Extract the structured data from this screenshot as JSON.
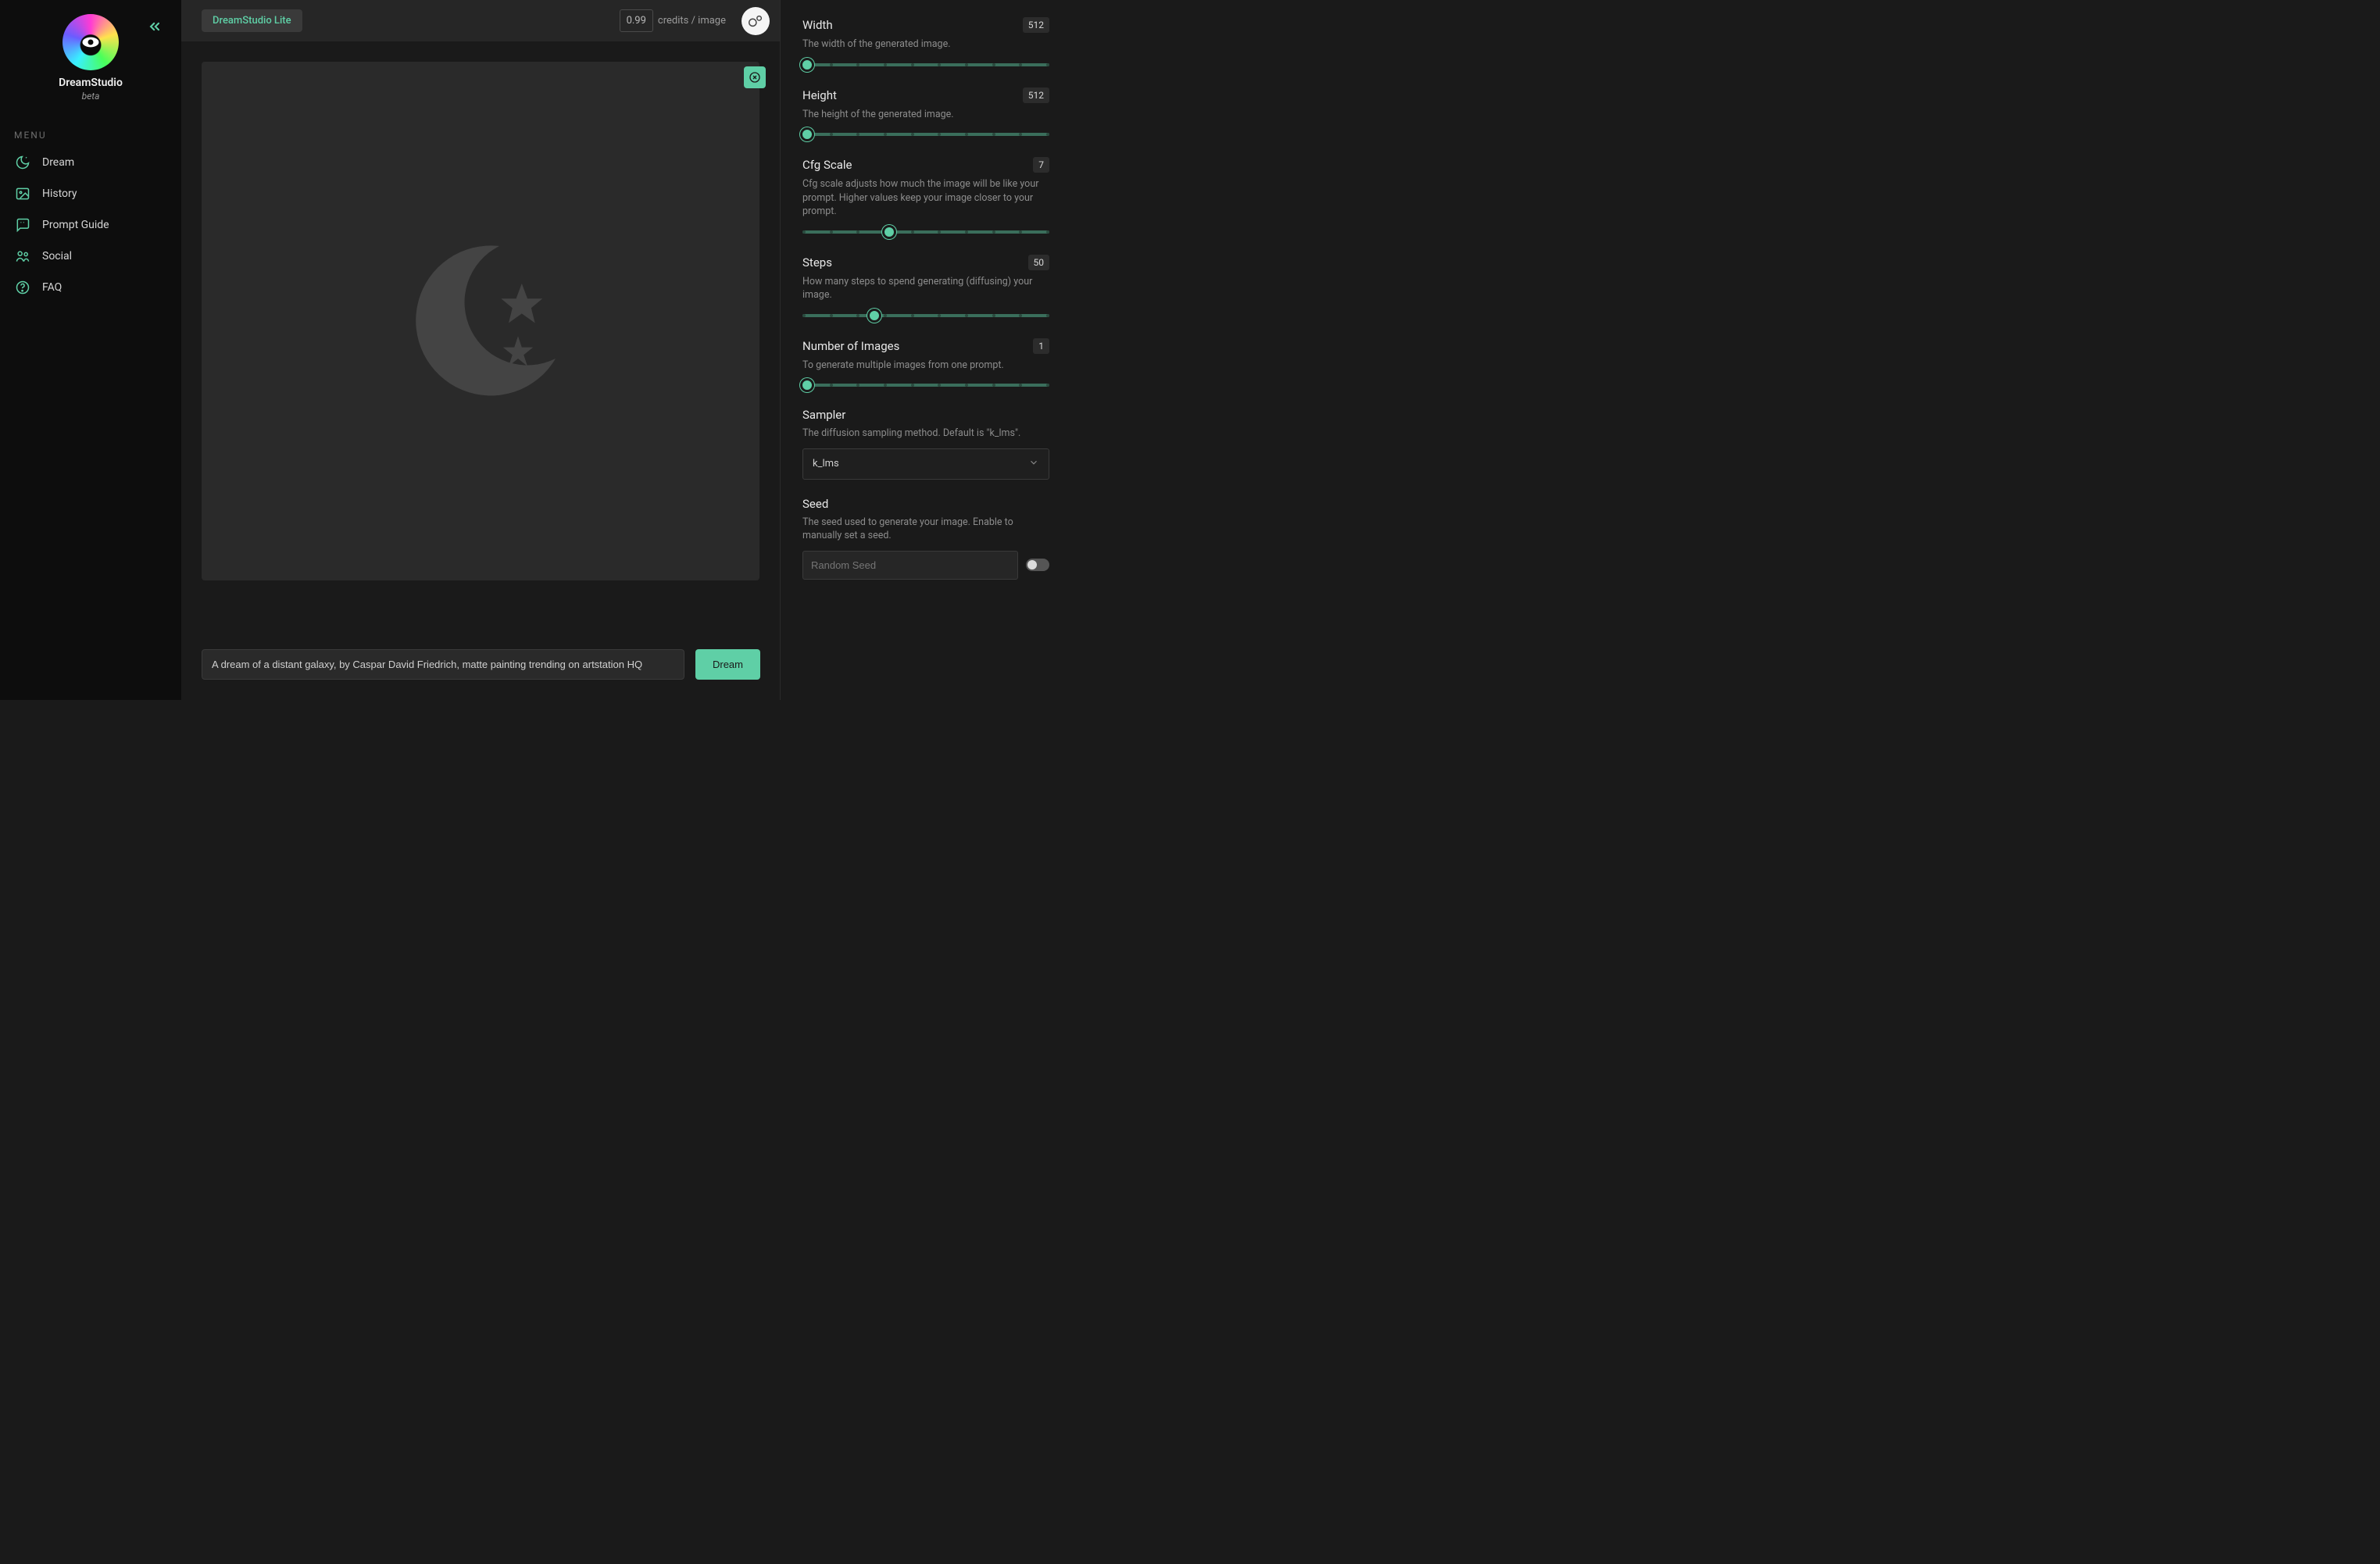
{
  "brand": {
    "name": "DreamStudio",
    "sub": "beta"
  },
  "sidebar": {
    "menu_header": "MENU",
    "items": [
      {
        "label": "Dream"
      },
      {
        "label": "History"
      },
      {
        "label": "Prompt Guide"
      },
      {
        "label": "Social"
      },
      {
        "label": "FAQ"
      }
    ]
  },
  "topbar": {
    "lite_label": "DreamStudio Lite",
    "credits_value": "0.99",
    "credits_label": "credits / image"
  },
  "prompt": {
    "value": "A dream of a distant galaxy, by Caspar David Friedrich, matte painting trending on artstation HQ",
    "button": "Dream"
  },
  "settings": {
    "width": {
      "label": "Width",
      "value": "512",
      "desc": "The width of the generated image.",
      "pct": 2
    },
    "height": {
      "label": "Height",
      "value": "512",
      "desc": "The height of the generated image.",
      "pct": 2
    },
    "cfg": {
      "label": "Cfg Scale",
      "value": "7",
      "desc": "Cfg scale adjusts how much the image will be like your prompt. Higher values keep your image closer to your prompt.",
      "pct": 35
    },
    "steps": {
      "label": "Steps",
      "value": "50",
      "desc": "How many steps to spend generating (diffusing) your image.",
      "pct": 29
    },
    "num": {
      "label": "Number of Images",
      "value": "1",
      "desc": "To generate multiple images from one prompt.",
      "pct": 2
    },
    "sampler": {
      "label": "Sampler",
      "desc": "The diffusion sampling method. Default is \"k_lms\".",
      "selected": "k_lms"
    },
    "seed": {
      "label": "Seed",
      "desc": "The seed used to generate your image. Enable to manually set a seed.",
      "placeholder": "Random Seed"
    }
  }
}
